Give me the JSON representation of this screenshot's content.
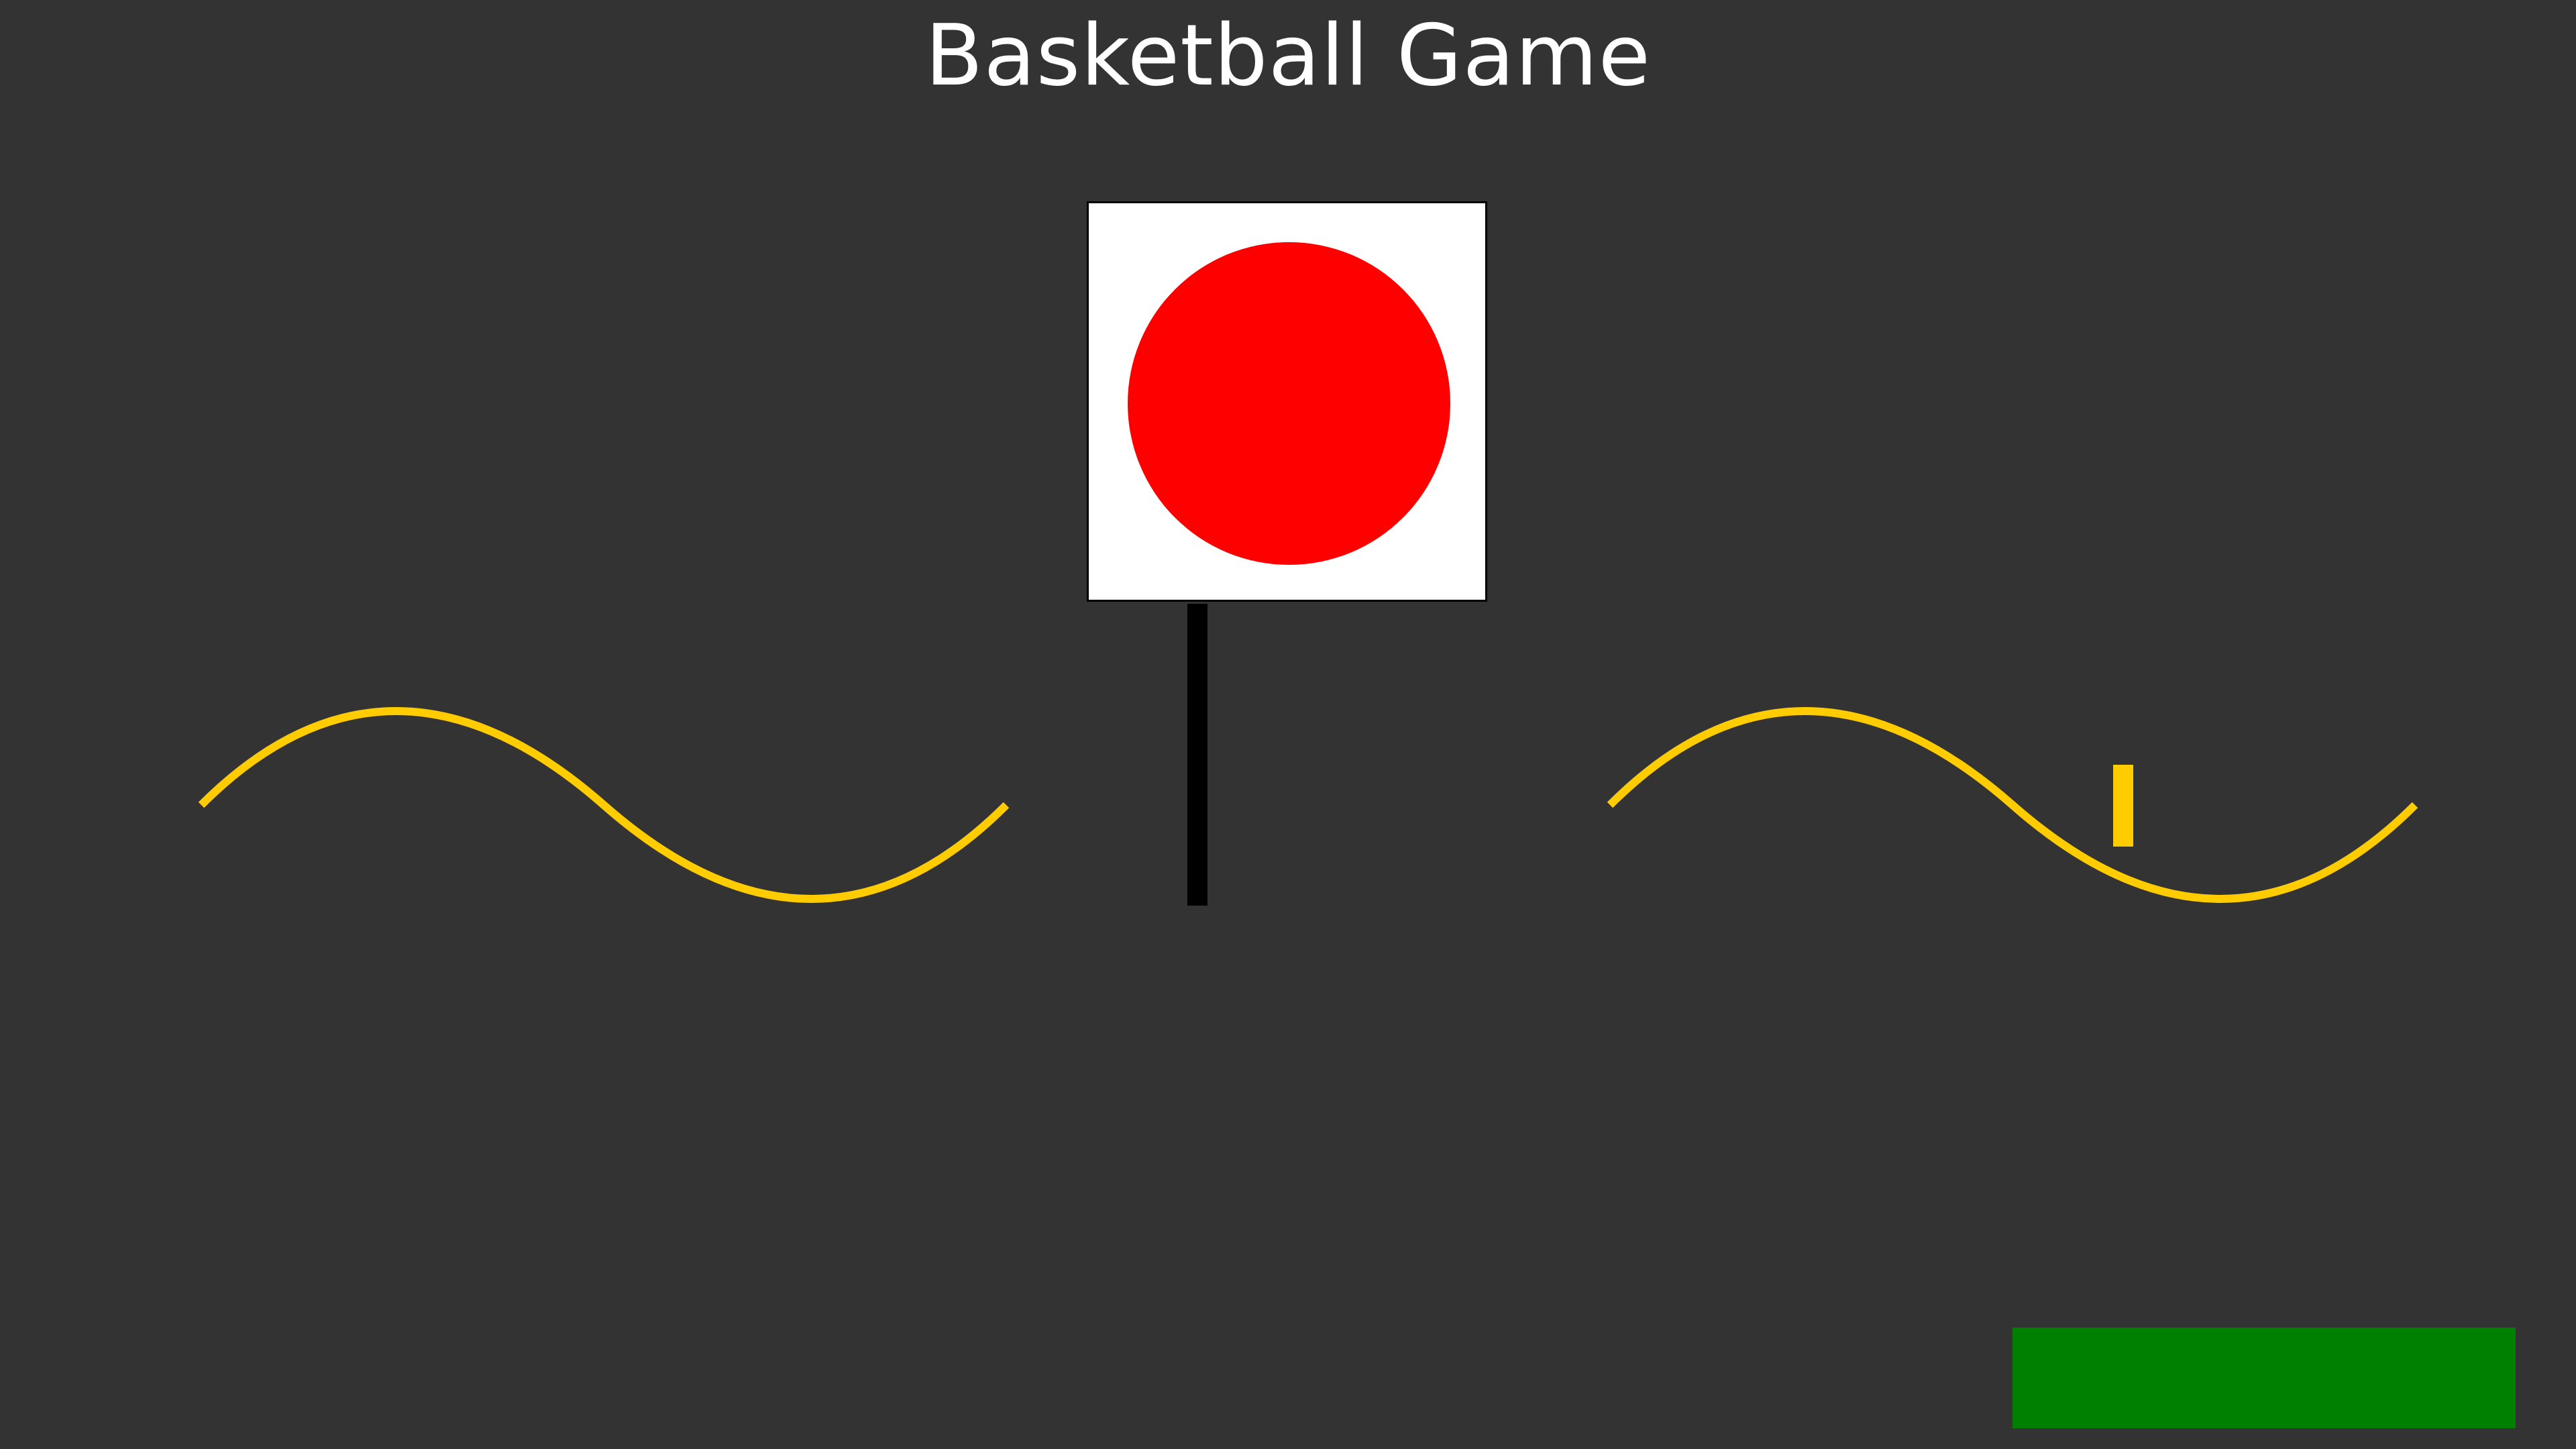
{
  "title": "Basketball Game",
  "colors": {
    "background": "#333333",
    "ball": "#ff0000",
    "backboard": "#ffffff",
    "pole": "#000000",
    "wave": "#ffcc00",
    "button": "#008000"
  },
  "action_button": {
    "label": ""
  }
}
